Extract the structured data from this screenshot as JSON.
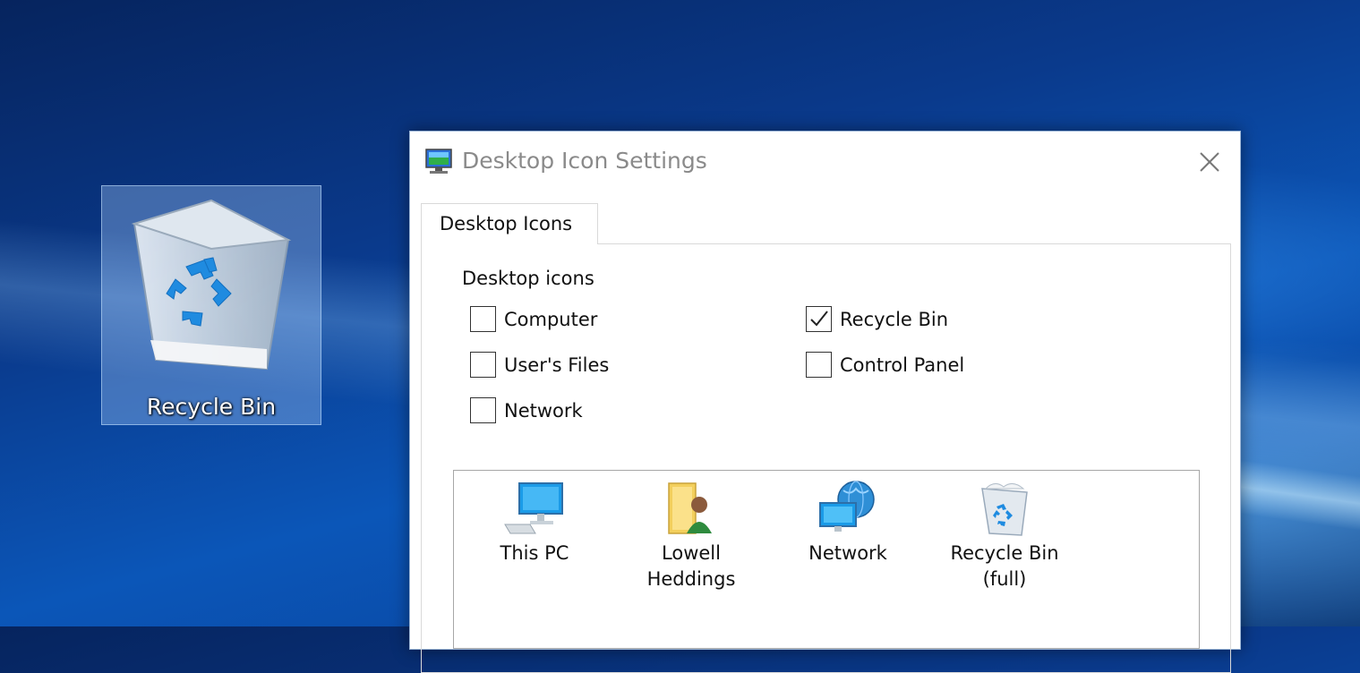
{
  "desktop": {
    "recycle_bin_label": "Recycle Bin"
  },
  "dialog": {
    "title": "Desktop Icon Settings",
    "tab_label": "Desktop Icons",
    "group_label": "Desktop icons",
    "checkboxes": [
      {
        "label": "Computer",
        "checked": false
      },
      {
        "label": "User's Files",
        "checked": false
      },
      {
        "label": "Network",
        "checked": false
      },
      {
        "label": "Recycle Bin",
        "checked": true
      },
      {
        "label": "Control Panel",
        "checked": false
      }
    ],
    "preview_icons": [
      {
        "line1": "This PC",
        "line2": "",
        "icon": "this-pc-icon"
      },
      {
        "line1": "Lowell",
        "line2": "Heddings",
        "icon": "user-folder-icon"
      },
      {
        "line1": "Network",
        "line2": "",
        "icon": "network-icon"
      },
      {
        "line1": "Recycle Bin",
        "line2": "(full)",
        "icon": "recycle-bin-full-icon"
      }
    ]
  },
  "colors": {
    "accent": "#1a7fd4",
    "selection": "#add2ff"
  }
}
